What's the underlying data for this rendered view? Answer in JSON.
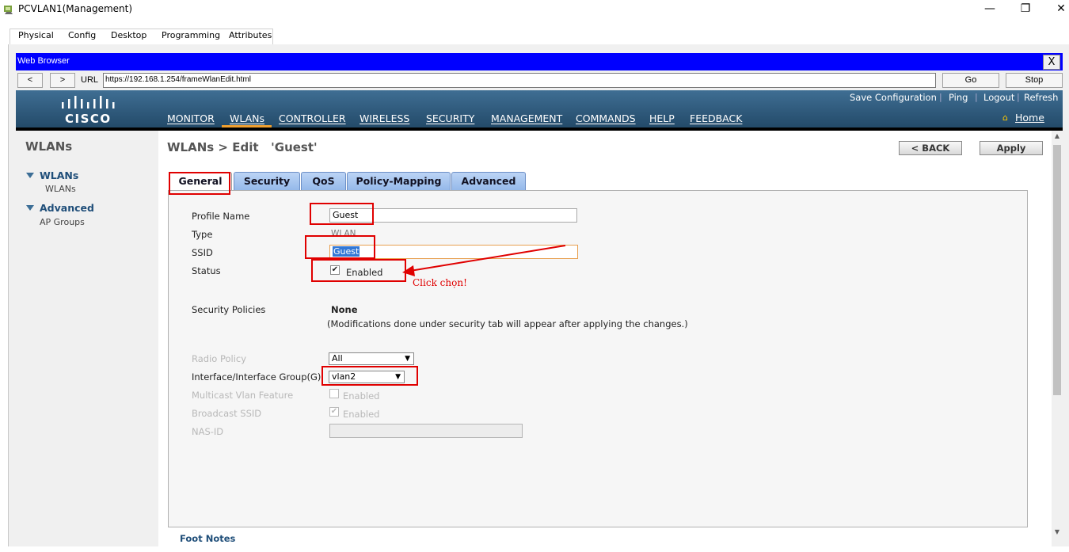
{
  "window": {
    "title": "PCVLAN1(Management)",
    "minimize": "—",
    "restore": "❐",
    "close": "✕"
  },
  "pt_tabs": [
    "Physical",
    "Config",
    "Desktop",
    "Programming",
    "Attributes"
  ],
  "browser": {
    "title": "Web Browser",
    "close": "X",
    "back": "<",
    "forward": ">",
    "url_label": "URL",
    "url": "https://192.168.1.254/frameWlanEdit.html",
    "go": "Go",
    "stop": "Stop"
  },
  "cisco": {
    "logo_text": "CISCO",
    "top_links": [
      "Save Configuration",
      "Ping",
      "Logout",
      "Refresh"
    ],
    "menu": [
      "MONITOR",
      "WLANs",
      "CONTROLLER",
      "WIRELESS",
      "SECURITY",
      "MANAGEMENT",
      "COMMANDS",
      "HELP",
      "FEEDBACK"
    ],
    "active_menu": "WLANs",
    "home": "Home"
  },
  "leftnav": {
    "title": "WLANs",
    "groups": [
      {
        "label": "WLANs",
        "items": [
          "WLANs"
        ]
      },
      {
        "label": "Advanced",
        "items": [
          "AP Groups"
        ]
      }
    ]
  },
  "main": {
    "title": "WLANs > Edit   'Guest'",
    "back_button": "< BACK",
    "apply_button": "Apply",
    "tabs": [
      "General",
      "Security",
      "QoS",
      "Policy-Mapping",
      "Advanced"
    ],
    "active_tab": "General",
    "fields": {
      "profile_name_label": "Profile Name",
      "profile_name_value": "Guest",
      "type_label": "Type",
      "type_value": "WLAN",
      "ssid_label": "SSID",
      "ssid_value": "Guest",
      "status_label": "Status",
      "status_checkbox_label": "Enabled",
      "status_checked": true,
      "security_policies_label": "Security Policies",
      "security_policies_value": "None",
      "security_note": "(Modifications done under security tab will appear after applying the changes.)",
      "radio_policy_label": "Radio Policy",
      "radio_policy_value": "All",
      "interface_label": "Interface/Interface Group(G)",
      "interface_value": "vlan2",
      "multicast_label": "Multicast Vlan Feature",
      "multicast_checkbox_label": "Enabled",
      "broadcast_label": "Broadcast SSID",
      "broadcast_checkbox_label": "Enabled",
      "nasid_label": "NAS-ID",
      "nasid_value": ""
    },
    "footnotes": "Foot Notes"
  },
  "annotation": {
    "text": "Click chọn!",
    "color": "#e00000"
  },
  "colors": {
    "browser_title_bg": "#0000ff",
    "cisco_header": "#2f5b7d",
    "menu_active": "#f0a030",
    "annotation": "#e00000"
  }
}
